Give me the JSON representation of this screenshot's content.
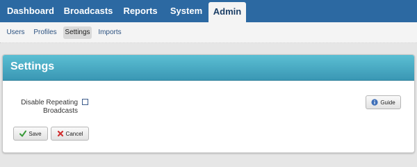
{
  "topnav": {
    "tabs": [
      {
        "label": "Dashboard"
      },
      {
        "label": "Broadcasts"
      },
      {
        "label": "Reports"
      },
      {
        "label": "System"
      },
      {
        "label": "Admin",
        "active": true
      }
    ]
  },
  "subnav": {
    "items": [
      {
        "label": "Users"
      },
      {
        "label": "Profiles"
      },
      {
        "label": "Settings",
        "active": true
      },
      {
        "label": "Imports"
      }
    ]
  },
  "panel": {
    "title": "Settings",
    "fields": {
      "disable_repeating_broadcasts": {
        "label": "Disable Repeating Broadcasts",
        "checked": false
      }
    }
  },
  "buttons": {
    "guide": {
      "label": "Guide",
      "icon": "info-icon"
    },
    "save": {
      "label": "Save",
      "icon": "checkmark-icon"
    },
    "cancel": {
      "label": "Cancel",
      "icon": "x-icon"
    }
  },
  "colors": {
    "nav_blue": "#2c69a2",
    "header_teal": "#3a97b4",
    "save_green": "#3a9a3a",
    "cancel_red": "#d03030",
    "info_blue": "#3e6fb8"
  }
}
